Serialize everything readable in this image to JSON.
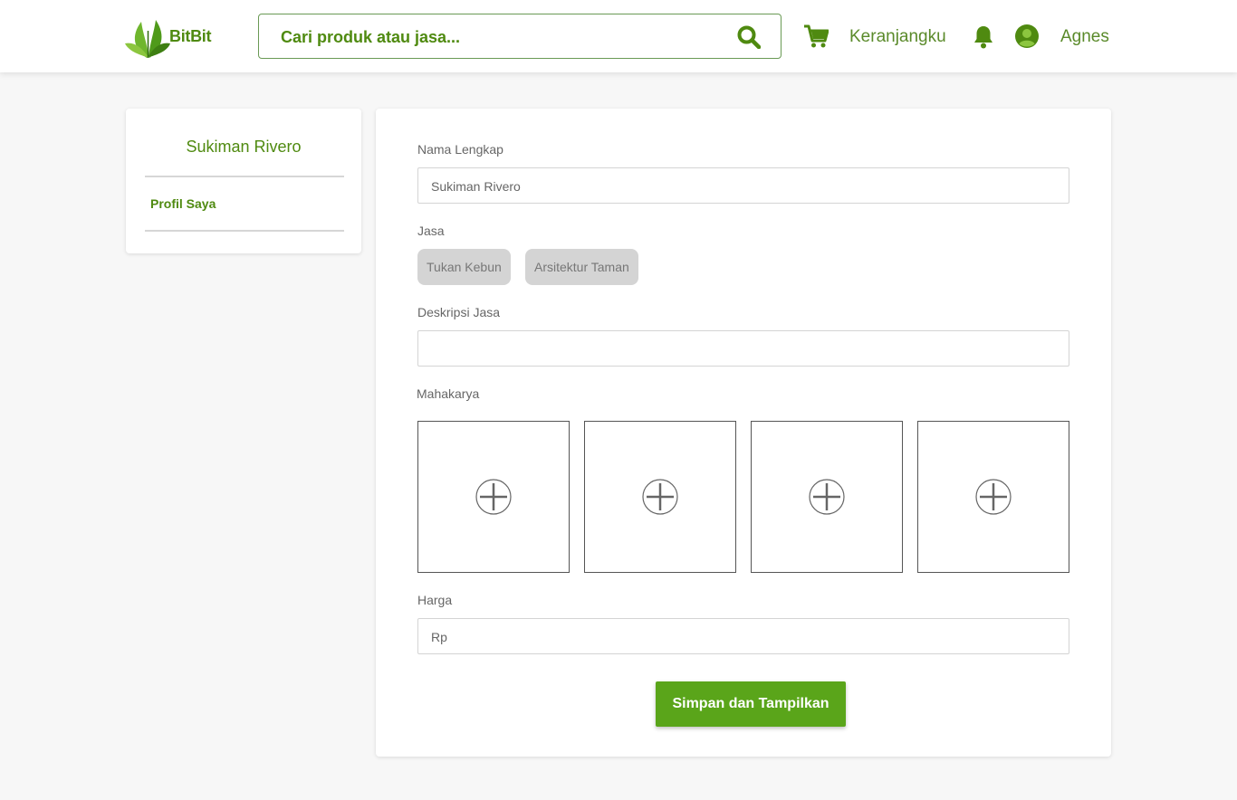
{
  "header": {
    "logo_text": "BitBit",
    "search": {
      "placeholder": "Cari produk atau jasa..."
    },
    "cart_label": "Keranjangku",
    "user_name": "Agnes"
  },
  "sidebar": {
    "name": "Sukiman Rivero",
    "items": [
      {
        "label": "Profil Saya"
      }
    ]
  },
  "form": {
    "full_name": {
      "label": "Nama Lengkap",
      "value": "Sukiman Rivero"
    },
    "services": {
      "label": "Jasa",
      "chips": [
        "Tukan Kebun",
        "Arsitektur Taman"
      ]
    },
    "description": {
      "label": "Deskripsi Jasa",
      "value": ""
    },
    "portfolio": {
      "label": "Mahakarya",
      "slots": 4
    },
    "price": {
      "label": "Harga",
      "placeholder": "Rp"
    },
    "submit_label": "Simpan dan Tampilkan"
  },
  "colors": {
    "brand": "#4f8a10",
    "button": "#5aa51a"
  },
  "icons": [
    "search-icon",
    "cart-icon",
    "bell-icon",
    "user-avatar-icon",
    "add-circle-icon"
  ]
}
